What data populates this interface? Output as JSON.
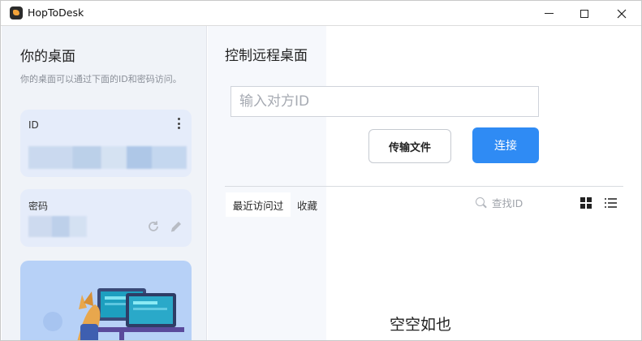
{
  "window": {
    "title": "HopToDesk",
    "controls": [
      "minimize",
      "maximize",
      "close"
    ]
  },
  "sidebar": {
    "heading": "你的桌面",
    "description": "你的桌面可以通过下面的ID和密码访问。",
    "id_card": {
      "label": "ID",
      "value_obscured": true
    },
    "password_card": {
      "label": "密码",
      "value_obscured": true
    }
  },
  "main": {
    "heading": "控制远程桌面",
    "id_input": {
      "placeholder": "输入对方ID",
      "value": ""
    },
    "transfer_button": "传输文件",
    "connect_button": "连接",
    "tabs": [
      {
        "label": "最近访问过",
        "active": true
      },
      {
        "label": "收藏",
        "active": false
      }
    ],
    "search": {
      "placeholder": "查找ID",
      "value": ""
    },
    "view_modes": [
      "grid-view",
      "list-view"
    ],
    "empty_message": "空空如也"
  },
  "colors": {
    "accent": "#2f8bf4",
    "sidebar_bg": "#f0f3f8",
    "card_bg": "#e5ecfa",
    "illustration_bg": "#b7d1f7"
  }
}
